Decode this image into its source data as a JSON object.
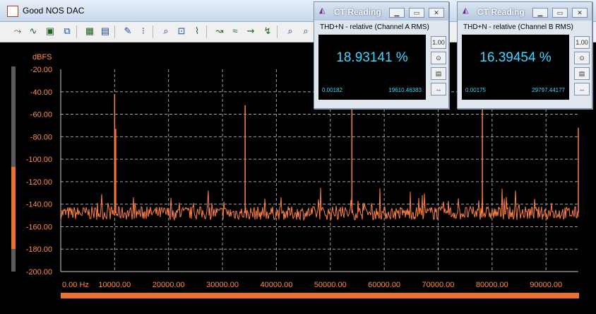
{
  "window": {
    "title": "Good NOS DAC"
  },
  "toolbar": {
    "buttons": [
      "zoom-in-x-icon",
      "zoom-out-x-icon",
      "save-icon",
      "copy-icon",
      "grid-icon",
      "print-setup-icon",
      "properties-icon",
      "scale-icon",
      "zoom-box-icon",
      "zoom-fit-icon",
      "trace-icon",
      "cursor-left-icon",
      "cursor-right-icon",
      "cursor-peak-icon",
      "cursor-next-icon",
      "find-icon",
      "find-next-icon"
    ]
  },
  "ct_windows": [
    {
      "title": "CT Reading",
      "label": "THD+N - relative (Channel A RMS)",
      "value": "18.93141 %",
      "min": "0.00182",
      "max": "19610.46383",
      "side_label": "1.00"
    },
    {
      "title": "CT Reading",
      "label": "THD+N - relative (Channel B RMS)",
      "value": "16.39454 %",
      "min": "0.00175",
      "max": "29797.44177",
      "side_label": "1.00"
    }
  ],
  "colors": {
    "plot_bg": "#000000",
    "trace": "#ff8040",
    "axis_text": "#ff8c4a",
    "grid": "#a0a0a0",
    "readout": "#3fd6ff"
  },
  "chart_data": {
    "type": "line",
    "ylabel": "dBFS",
    "xlim": [
      0,
      96000
    ],
    "ylim": [
      -200,
      -20
    ],
    "y_ticks": [
      "-20.00",
      "-40.00",
      "-60.00",
      "-80.00",
      "-100.00",
      "-120.00",
      "-140.00",
      "-160.00",
      "-180.00",
      "-200.00"
    ],
    "x_ticks": [
      "0.00 Hz",
      "10000.00",
      "20000.00",
      "30000.00",
      "40000.00",
      "50000.00",
      "60000.00",
      "70000.00",
      "80000.00",
      "90000.00"
    ],
    "grid": true,
    "noise_floor": -148,
    "peaks": [
      {
        "x": 10000,
        "y": -42
      },
      {
        "x": 10200,
        "y": -73
      },
      {
        "x": 34200,
        "y": -52
      },
      {
        "x": 54000,
        "y": -45
      },
      {
        "x": 78200,
        "y": -55
      },
      {
        "x": 96000,
        "y": -72
      }
    ]
  }
}
